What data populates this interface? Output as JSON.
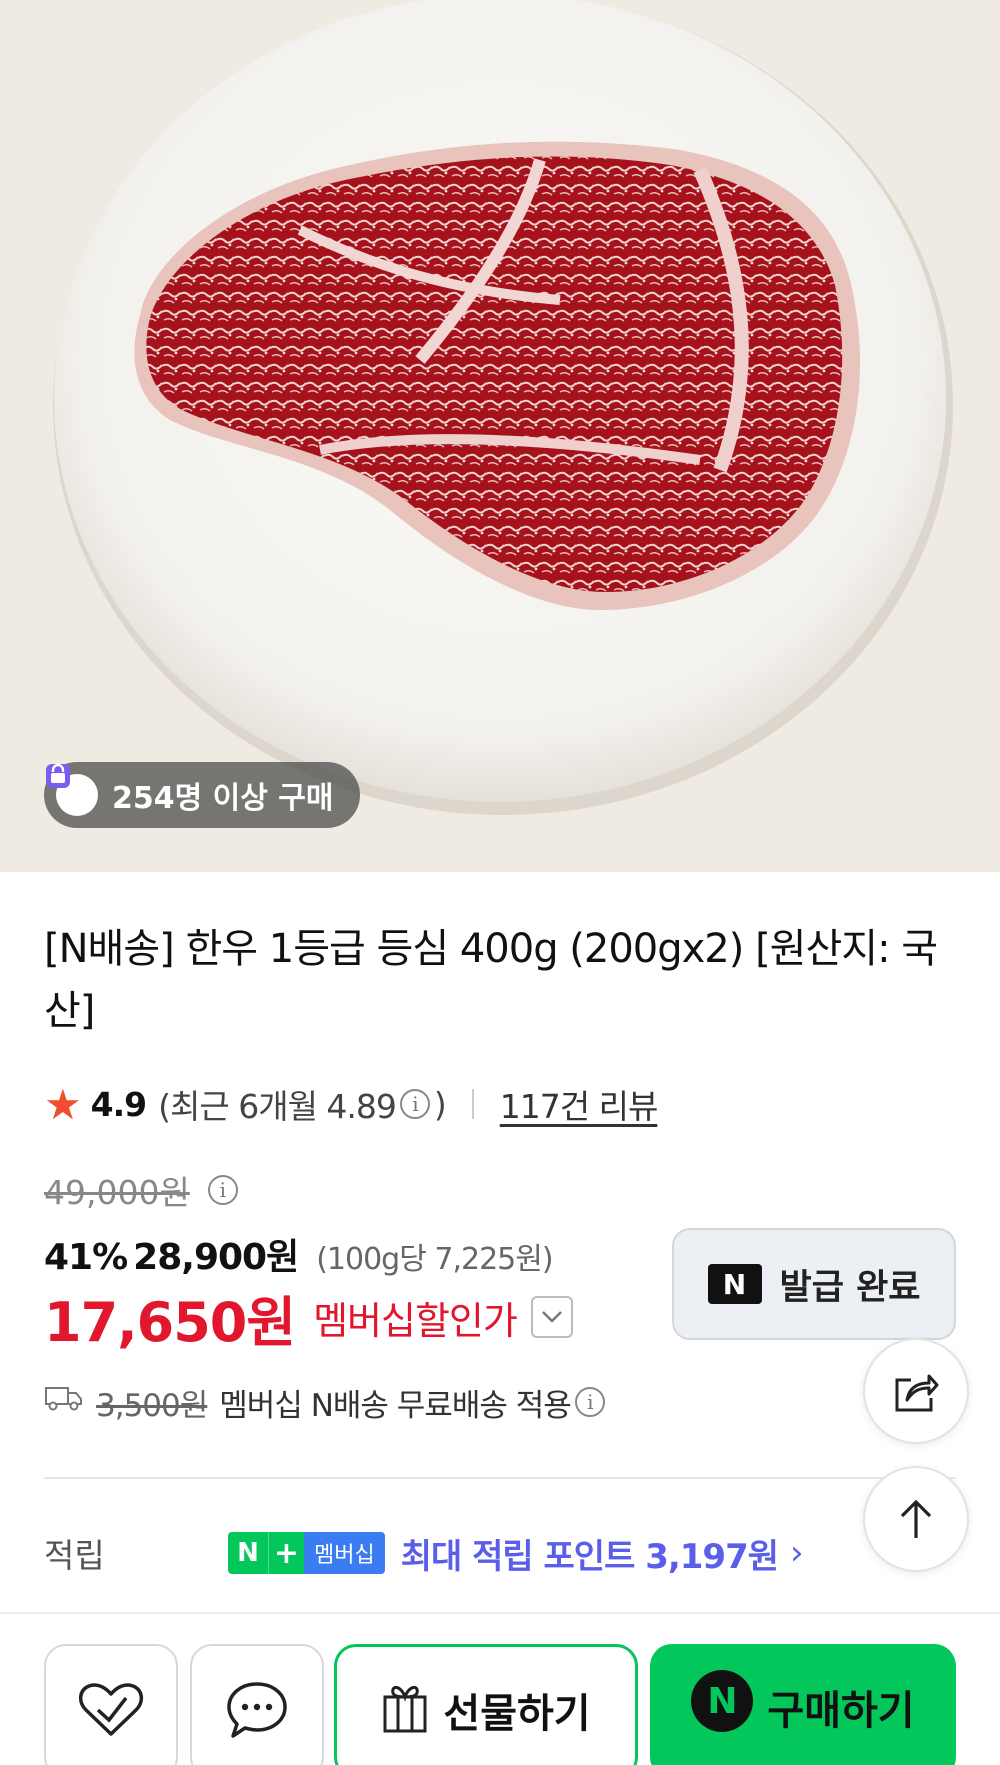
{
  "product": {
    "image_alt": "",
    "buyer_badge": "254명 이상 구매",
    "title": "[N배송] 한우 1등급 등심 400g (200gx2) [원산지: 국산]"
  },
  "rating": {
    "score": "4.9",
    "recent_prefix": "(최근 6개월 4.89",
    "recent_suffix": ")",
    "review_count": "117건 리뷰"
  },
  "price": {
    "original": "49,000원",
    "discount_pct": "41%",
    "sale_price": "28,900원",
    "unit_price": "(100g당 7,225원)",
    "member_price": "17,650원",
    "member_label": "멤버십할인가"
  },
  "coupon": {
    "label": "발급 완료",
    "logo": "N"
  },
  "shipping": {
    "original_fee": "3,500원",
    "text": "멤버십 N배송 무료배송 적용"
  },
  "points": {
    "label": "적립",
    "badge_n": "N",
    "badge_plus": "+",
    "badge_text": "멤버십",
    "max_text": "최대 적립 포인트 3,197원",
    "arrow": "›"
  },
  "bottom_bar": {
    "gift_label": "선물하기",
    "buy_label": "구매하기",
    "buy_logo": "N"
  },
  "icons": {
    "star": "star-icon",
    "info": "info-icon",
    "truck": "truck-icon",
    "share": "share-icon",
    "top": "arrow-up-icon",
    "like": "heart-check-icon",
    "talk": "chat-bubble-icon",
    "gift": "gift-icon"
  },
  "colors": {
    "brand_green": "#03c75a",
    "sale_red": "#e0172d",
    "points_purple": "#5a5ee8",
    "star": "#f04e2f"
  }
}
